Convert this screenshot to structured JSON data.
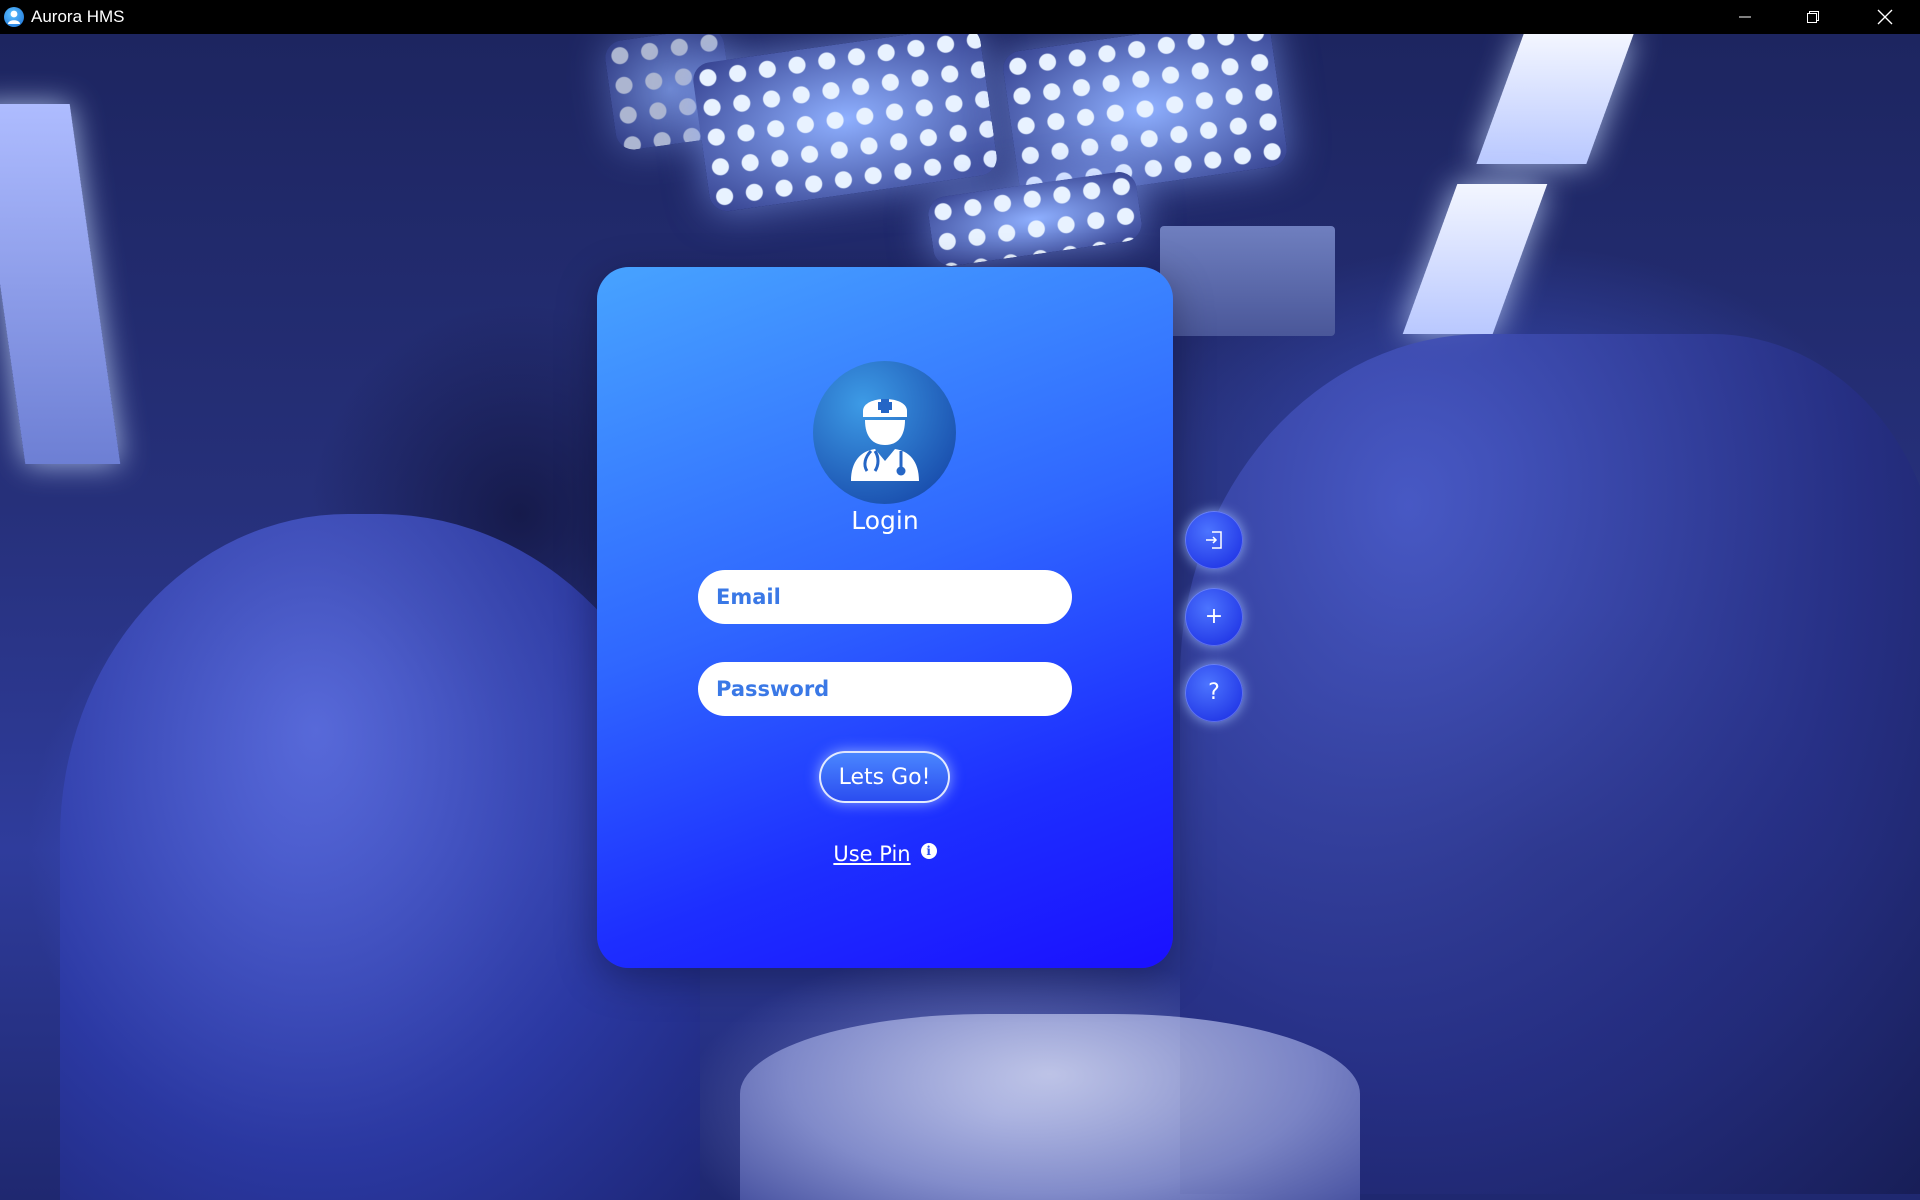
{
  "window": {
    "title": "Aurora HMS",
    "controls": [
      "minimize-icon",
      "restore-icon",
      "close-icon"
    ]
  },
  "login": {
    "title": "Login",
    "email_placeholder": "Email",
    "password_placeholder": "Password",
    "submit_label": "Lets Go!",
    "pin_link": "Use Pin",
    "avatar_icon": "doctor-icon",
    "info_icon": "info-icon"
  },
  "side_actions": {
    "login_icon": "login-icon",
    "add_label": "+",
    "help_label": "?"
  },
  "colors": {
    "card_top": "#47a3ff",
    "card_bottom": "#1a10ff",
    "field_text": "#2d6be0",
    "title_bar": "#000000"
  }
}
